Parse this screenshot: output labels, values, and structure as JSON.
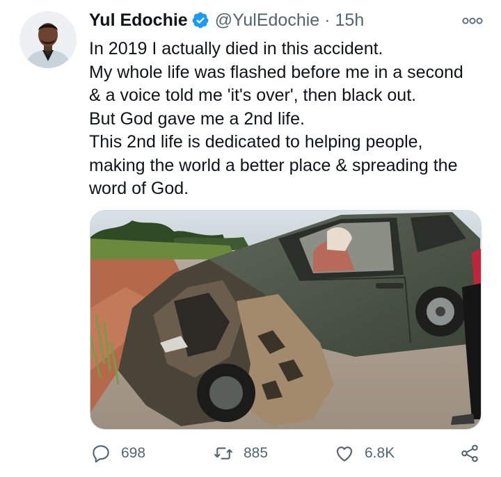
{
  "tweet": {
    "author": {
      "display_name": "Yul Edochie",
      "handle": "@YulEdochie",
      "verified": true
    },
    "separator": "·",
    "timestamp": "15h",
    "text_lines": [
      "In 2019 I actually died in this accident.",
      "My whole life was flashed before me in a second",
      "& a voice told me 'it's over', then black out.",
      "But God gave me a 2nd life.",
      "This 2nd life is dedicated to helping people,",
      "making the world a better place & spreading the",
      "word of God."
    ],
    "stats": {
      "replies": "698",
      "retweets": "885",
      "likes": "6.8K"
    }
  },
  "icons": {
    "verified": "verified-badge-icon",
    "more": "more-options-icon",
    "reply": "reply-bubble-icon",
    "retweet": "retweet-icon",
    "like": "heart-icon",
    "share": "share-icon"
  },
  "colors": {
    "text_primary": "#0f1419",
    "text_secondary": "#536471",
    "verified_blue": "#1d9bf0",
    "border": "#cfd9de"
  }
}
